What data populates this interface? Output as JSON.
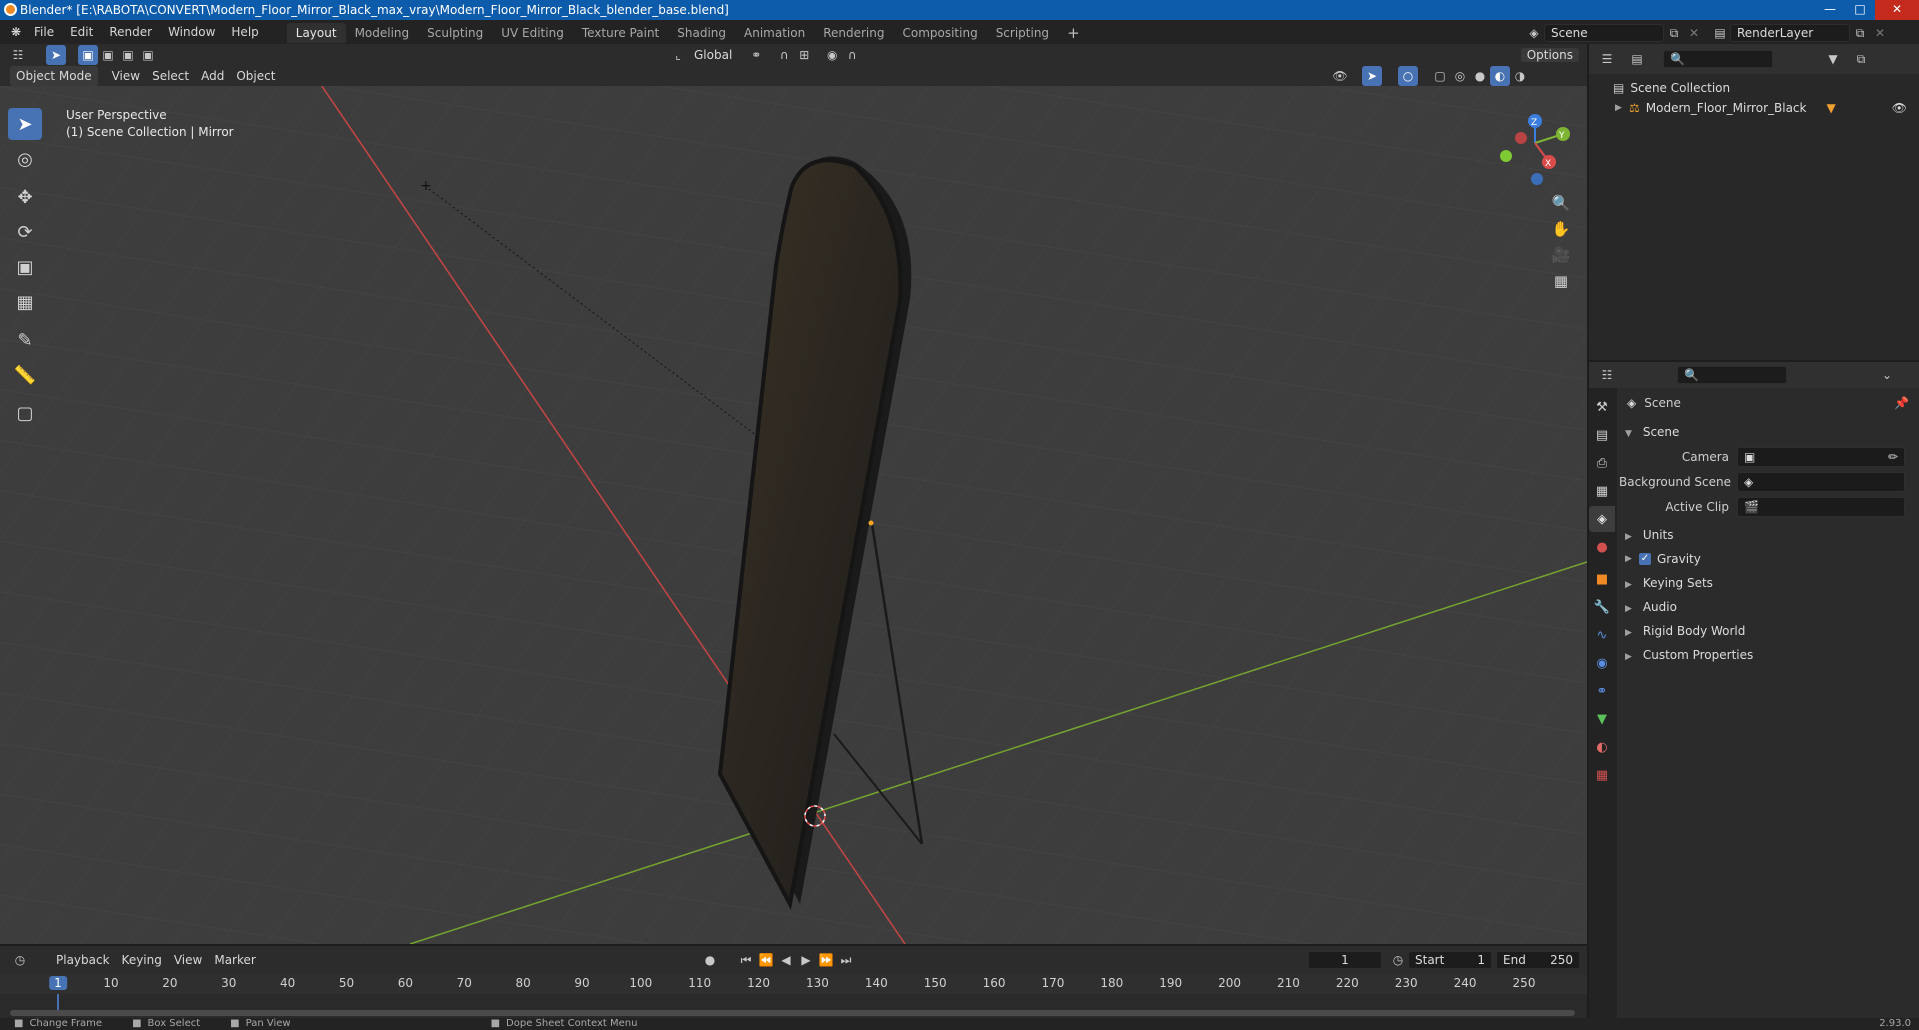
{
  "window": {
    "title": "Blender* [E:\\RABOTA\\CONVERT\\Modern_Floor_Mirror_Black_max_vray\\Modern_Floor_Mirror_Black_blender_base.blend]"
  },
  "menu": [
    "File",
    "Edit",
    "Render",
    "Window",
    "Help"
  ],
  "workspaces": [
    "Layout",
    "Modeling",
    "Sculpting",
    "UV Editing",
    "Texture Paint",
    "Shading",
    "Animation",
    "Rendering",
    "Compositing",
    "Scripting"
  ],
  "active_workspace": "Layout",
  "scene_selector": "Scene",
  "renderlayer_selector": "RenderLayer",
  "viewport_header": {
    "mode": "Object Mode",
    "menus": [
      "View",
      "Select",
      "Add",
      "Object"
    ],
    "transform_orientation": "Global",
    "options_label": "Options"
  },
  "viewport": {
    "perspective_label": "User Perspective",
    "collection_label": "(1) Scene Collection | Mirror",
    "gizmo": {
      "x": "X",
      "y": "Y",
      "z": "Z"
    }
  },
  "outliner": {
    "root": "Scene Collection",
    "items": [
      "Modern_Floor_Mirror_Black"
    ]
  },
  "properties": {
    "context": "Scene",
    "panel_title": "Scene",
    "fields": [
      {
        "label": "Camera"
      },
      {
        "label": "Background Scene"
      },
      {
        "label": "Active Clip"
      }
    ],
    "subpanels": [
      "Units",
      "Gravity",
      "Keying Sets",
      "Audio",
      "Rigid Body World",
      "Custom Properties"
    ],
    "gravity_checked": true
  },
  "timeline": {
    "menus": [
      "Playback",
      "Keying",
      "View",
      "Marker"
    ],
    "current_frame": "1",
    "start_label": "Start",
    "start_value": "1",
    "end_label": "End",
    "end_value": "250",
    "ruler": [
      "1",
      "10",
      "20",
      "30",
      "40",
      "50",
      "60",
      "70",
      "80",
      "90",
      "100",
      "110",
      "120",
      "130",
      "140",
      "150",
      "160",
      "170",
      "180",
      "190",
      "200",
      "210",
      "220",
      "230",
      "240",
      "250"
    ]
  },
  "statusbar": {
    "items": [
      "Change Frame",
      "Box Select",
      "Pan View",
      "Dope Sheet Context Menu"
    ],
    "version": "2.93.0"
  },
  "colors": {
    "accent": "#4772b3",
    "titlebar": "#0d5cab",
    "x_axis": "#d94b4b",
    "y_axis": "#7fb534",
    "z_axis": "#3c7de0"
  }
}
